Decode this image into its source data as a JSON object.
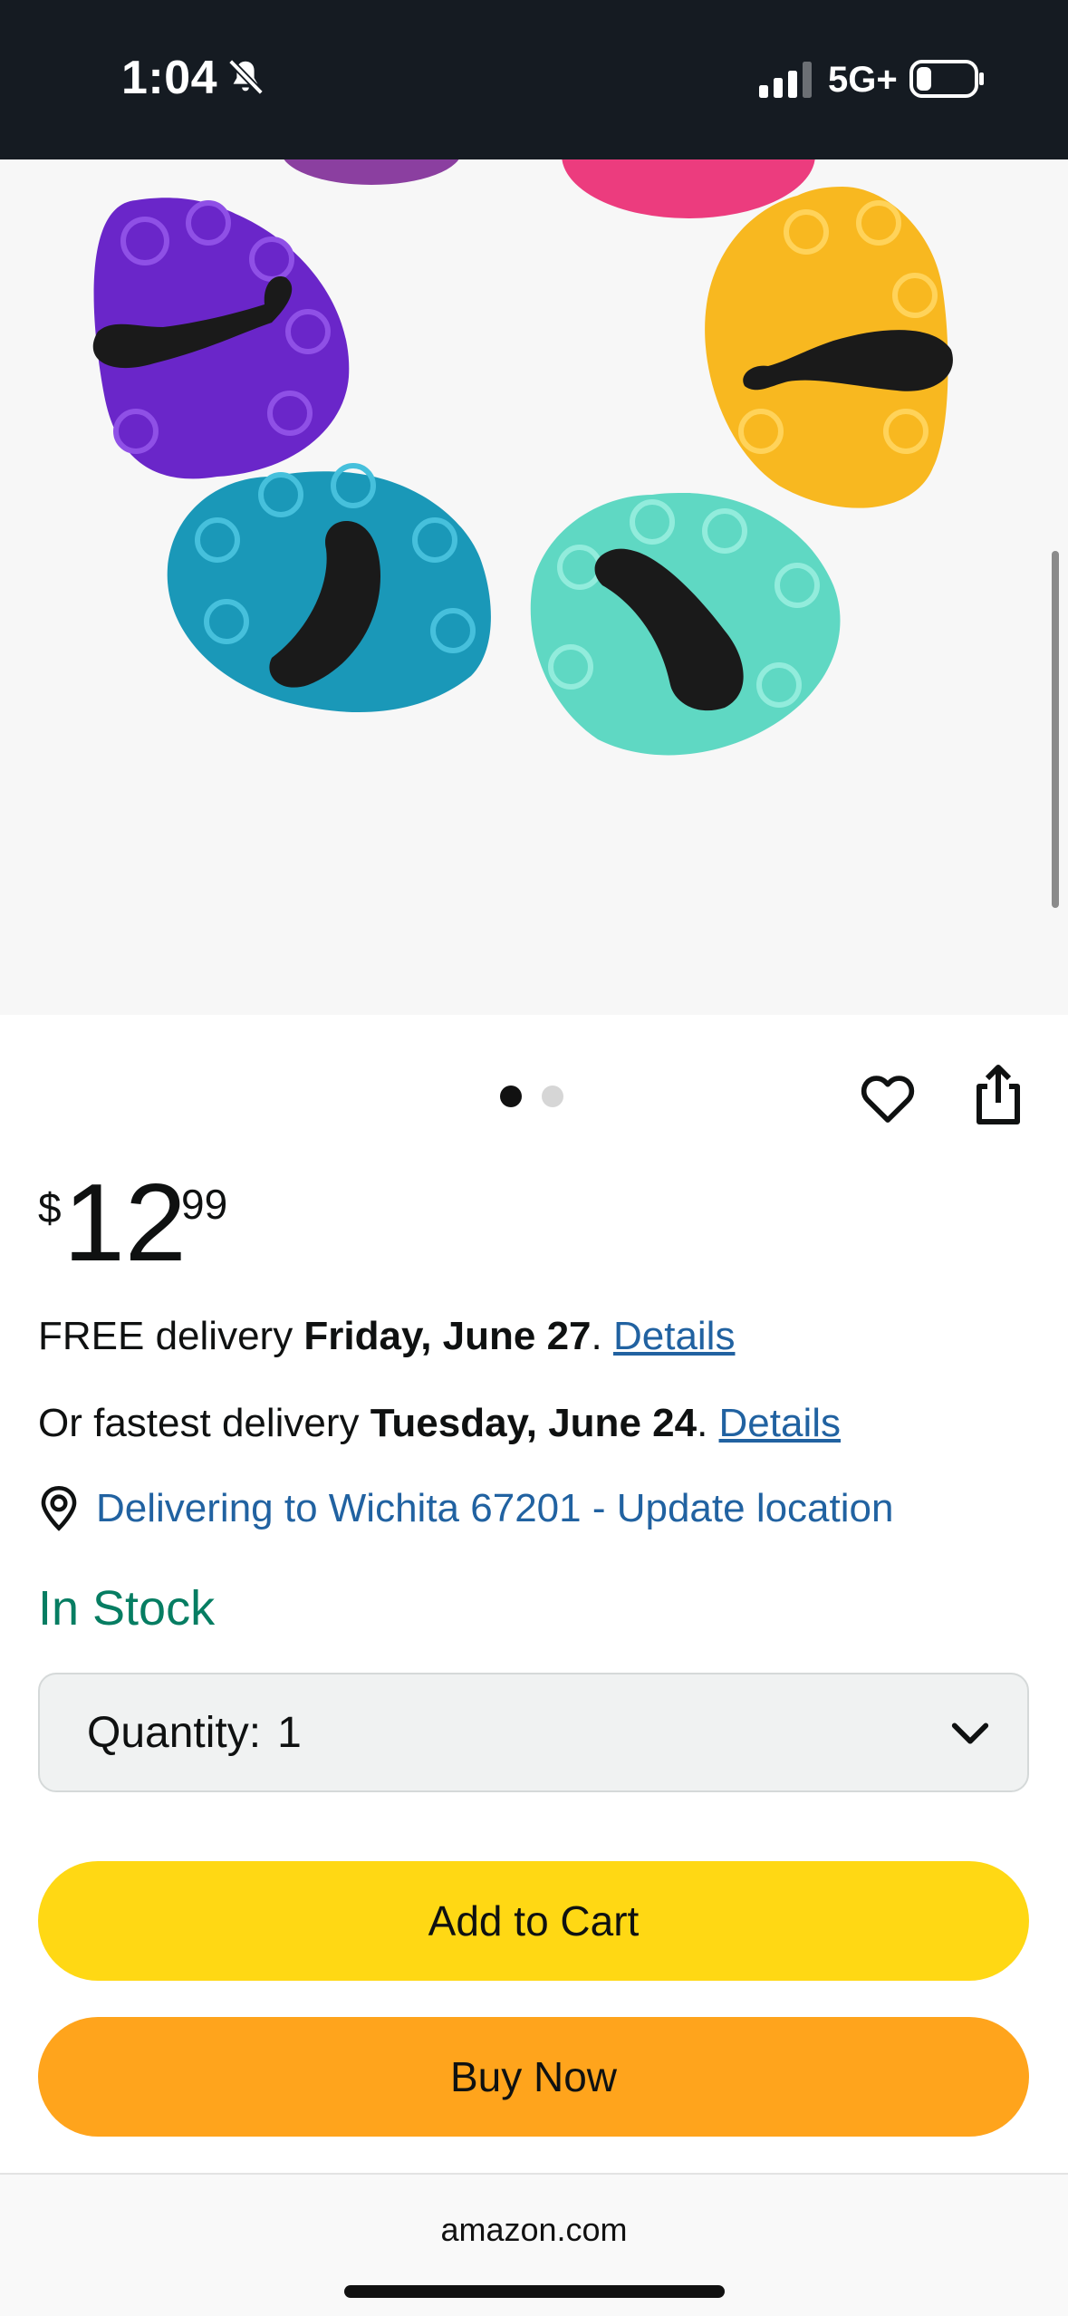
{
  "status_bar": {
    "time": "1:04",
    "network": "5G+",
    "silent_icon": "bell-slash-icon",
    "signal_icon": "cellular-signal-icon",
    "battery_icon": "battery-icon"
  },
  "product": {
    "image_icon": "peacock-silicone-beads-photo",
    "carousel": {
      "total": 2,
      "active_index": 0
    },
    "wishlist_icon": "heart-icon",
    "share_icon": "share-icon"
  },
  "price": {
    "symbol": "$",
    "whole": "12",
    "fraction": "99"
  },
  "delivery": {
    "free_prefix": "FREE delivery ",
    "free_date": "Friday, June 27",
    "free_suffix": ". ",
    "free_link": "Details",
    "fast_prefix": "Or fastest delivery ",
    "fast_date": "Tuesday, June 24",
    "fast_suffix": ". ",
    "fast_link": "Details",
    "location_icon": "location-pin-icon",
    "location_text": "Delivering to Wichita 67201 - Update location"
  },
  "stock": {
    "status": "In Stock",
    "color": "#067d62"
  },
  "quantity": {
    "label": "Quantity:",
    "value": "1",
    "chevron_icon": "chevron-down-icon"
  },
  "buttons": {
    "add_to_cart": "Add to Cart",
    "buy_now": "Buy Now",
    "add_to_cart_color": "#ffd814",
    "buy_now_color": "#ffa41c"
  },
  "browser": {
    "url": "amazon.com"
  },
  "colors": {
    "status_bar_bg": "#151b22",
    "link": "#2162a1"
  }
}
